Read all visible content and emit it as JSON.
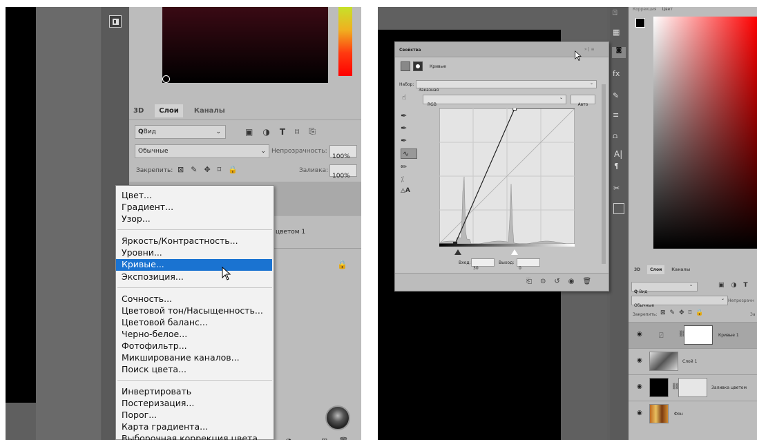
{
  "left": {
    "panel_tabs": [
      "3D",
      "Слои",
      "Каналы"
    ],
    "filter_kind": "Вид",
    "blend_mode": "Обычные",
    "opacity_label": "Непрозрачность:",
    "opacity_value": "100%",
    "lock_label": "Закрепить:",
    "fill_label": "Заливка:",
    "fill_value": "100%",
    "layer_partial_name": "цветом 1",
    "menu": {
      "group1": [
        "Цвет...",
        "Градиент...",
        "Узор..."
      ],
      "group2": [
        "Яркость/Контрастность...",
        "Уровни...",
        "Кривые...",
        "Экспозиция..."
      ],
      "group3": [
        "Сочность...",
        "Цветовой тон/Насыщенность...",
        "Цветовой баланс...",
        "Черно-белое...",
        "Фотофильтр...",
        "Микширование каналов...",
        "Поиск цвета..."
      ],
      "group4": [
        "Инвертировать",
        "Постеризация...",
        "Порог...",
        "Карта градиента...",
        "Выборочная коррекция цвета..."
      ],
      "selected": "Кривые..."
    }
  },
  "right": {
    "props_title": "Свойства",
    "props_header_label": "Кривые",
    "preset_label": "Набор:",
    "preset_value": "Заказная",
    "channel_value": "RGB",
    "auto_button": "Авто",
    "input_label": "Вход:",
    "input_value": "30",
    "output_label": "Выход:",
    "output_value": "0",
    "top_tabs": [
      "Коррекция",
      "Цвет"
    ],
    "panel_tabs": [
      "3D",
      "Слои",
      "Каналы"
    ],
    "filter_kind": "Вид",
    "blend_mode": "Обычные",
    "opacity_label": "Непрозрачн",
    "lock_label": "Закрепить:",
    "fill_label": "За",
    "layers": [
      {
        "name": "Кривые 1"
      },
      {
        "name": "Слой 1"
      },
      {
        "name": "Заливка цветом"
      },
      {
        "name": "Фон"
      }
    ],
    "histogram_peaks": [
      {
        "input": 0.18,
        "height": 0.6
      },
      {
        "input": 0.53,
        "height": 0.45
      }
    ],
    "curve_points": [
      {
        "input": 30,
        "output": 0
      },
      {
        "input": 142,
        "output": 255
      }
    ]
  },
  "colors": {
    "selected_menu": "#1a73d1",
    "panel_gray": "#bdbdbd",
    "dark_gray": "#5e5e5e"
  }
}
